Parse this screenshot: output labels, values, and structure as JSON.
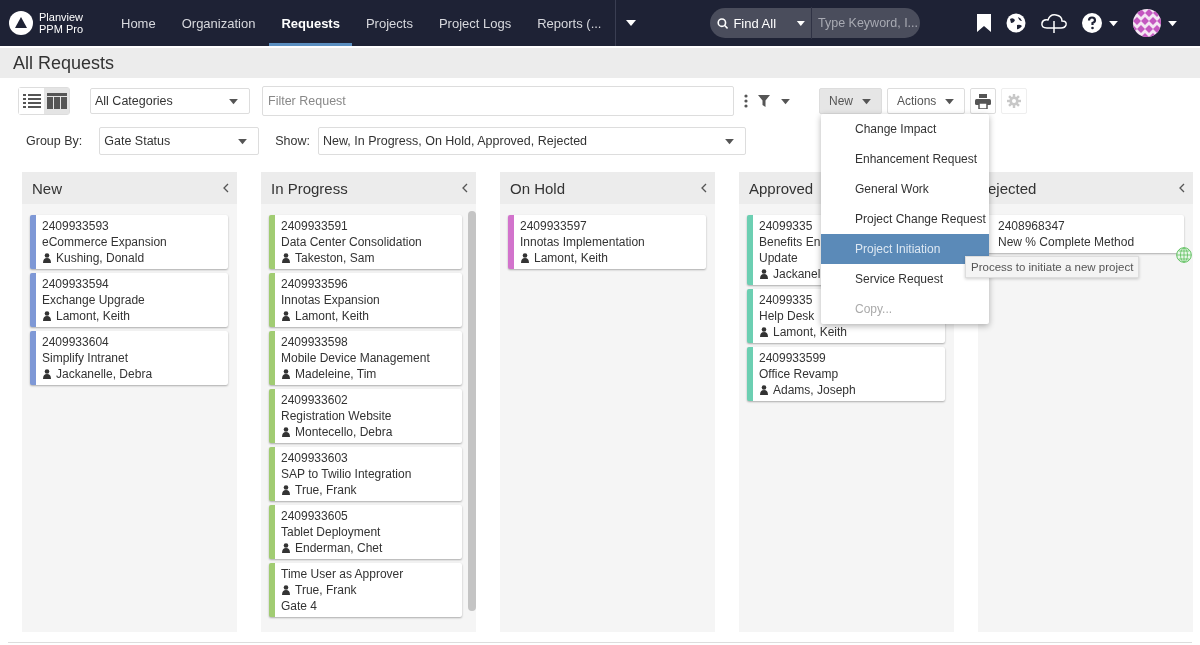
{
  "nav": {
    "brand_line1": "Planview",
    "brand_line2": "PPM Pro",
    "items": [
      {
        "label": "Home",
        "selected": false
      },
      {
        "label": "Organization",
        "selected": false
      },
      {
        "label": "Requests",
        "selected": true
      },
      {
        "label": "Projects",
        "selected": false
      },
      {
        "label": "Project Logs",
        "selected": false
      },
      {
        "label": "Reports (...",
        "selected": false
      }
    ],
    "search": {
      "scope": "Find All",
      "placeholder": "Type Keyword, I..."
    }
  },
  "page_title": "All Requests",
  "toolbar": {
    "views": [
      {
        "kind": "list",
        "selected": false
      },
      {
        "kind": "board",
        "selected": true
      }
    ],
    "category": "All Categories",
    "filter": {
      "placeholder": "Filter Request"
    },
    "new_button": "New",
    "new_open": true,
    "actions_button": "Actions",
    "settings_disabled": true
  },
  "group_row": {
    "group_label": "Group By:",
    "group_value": "Gate Status",
    "show_label": "Show:",
    "show_value": "New, In Progress, On Hold, Approved, Rejected"
  },
  "columns": [
    {
      "title": "New",
      "color": "#7e98d6",
      "scrollbar": false,
      "cards": [
        {
          "id": "2409933593",
          "title": "eCommerce Expansion",
          "person": "Kushing, Donald"
        },
        {
          "id": "2409933594",
          "title": "Exchange Upgrade",
          "person": "Lamont, Keith"
        },
        {
          "id": "2409933604",
          "title": "Simplify Intranet",
          "person": "Jackanelle, Debra"
        }
      ]
    },
    {
      "title": "In Progress",
      "color": "#a1cc72",
      "scrollbar": true,
      "cards": [
        {
          "id": "2409933591",
          "title": "Data Center Consolidation",
          "person": "Takeston, Sam"
        },
        {
          "id": "2409933596",
          "title": "Innotas Expansion",
          "person": "Lamont, Keith"
        },
        {
          "id": "2409933598",
          "title": "Mobile Device Management",
          "person": "Madeleine, Tim"
        },
        {
          "id": "2409933602",
          "title": "Registration Website",
          "person": "Montecello, Debra"
        },
        {
          "id": "2409933603",
          "title": "SAP to Twilio Integration",
          "person": "True, Frank"
        },
        {
          "id": "2409933605",
          "title": "Tablet Deployment",
          "person": "Enderman, Chet"
        },
        {
          "title": "Time User as Approver",
          "person": "True, Frank",
          "extra": "Gate 4"
        }
      ]
    },
    {
      "title": "On Hold",
      "color": "#d273cc",
      "scrollbar": false,
      "cards": [
        {
          "id": "2409933597",
          "title": "Innotas Implementation",
          "person": "Lamont, Keith"
        }
      ]
    },
    {
      "title": "Approved",
      "color": "#6ccfb2",
      "scrollbar": false,
      "cards": [
        {
          "id": "24099335",
          "title": "Benefits En",
          "title_line2": "Update",
          "person": "Jackanel"
        },
        {
          "id": "24099335",
          "title": "Help Desk",
          "person": "Lamont, Keith"
        },
        {
          "id": "2409933599",
          "title": "Office Revamp",
          "person": "Adams, Joseph"
        }
      ]
    },
    {
      "title": "ejected",
      "color": "#ffffff",
      "scrollbar": false,
      "cards": [
        {
          "id": "2408968347",
          "title": "New % Complete Method",
          "badge": true
        }
      ]
    }
  ],
  "new_menu": {
    "items": [
      {
        "label": "Change Impact",
        "selected": false,
        "disabled": false
      },
      {
        "label": "Enhancement Request",
        "selected": false,
        "disabled": false
      },
      {
        "label": "General Work",
        "selected": false,
        "disabled": false
      },
      {
        "label": "Project Change Request",
        "selected": false,
        "disabled": false
      },
      {
        "label": "Project Initiation",
        "selected": true,
        "disabled": false
      },
      {
        "label": "Service Request",
        "selected": false,
        "disabled": false
      },
      {
        "label": "Copy...",
        "selected": false,
        "disabled": true
      }
    ]
  },
  "tooltip": "Process to initiate a new project"
}
